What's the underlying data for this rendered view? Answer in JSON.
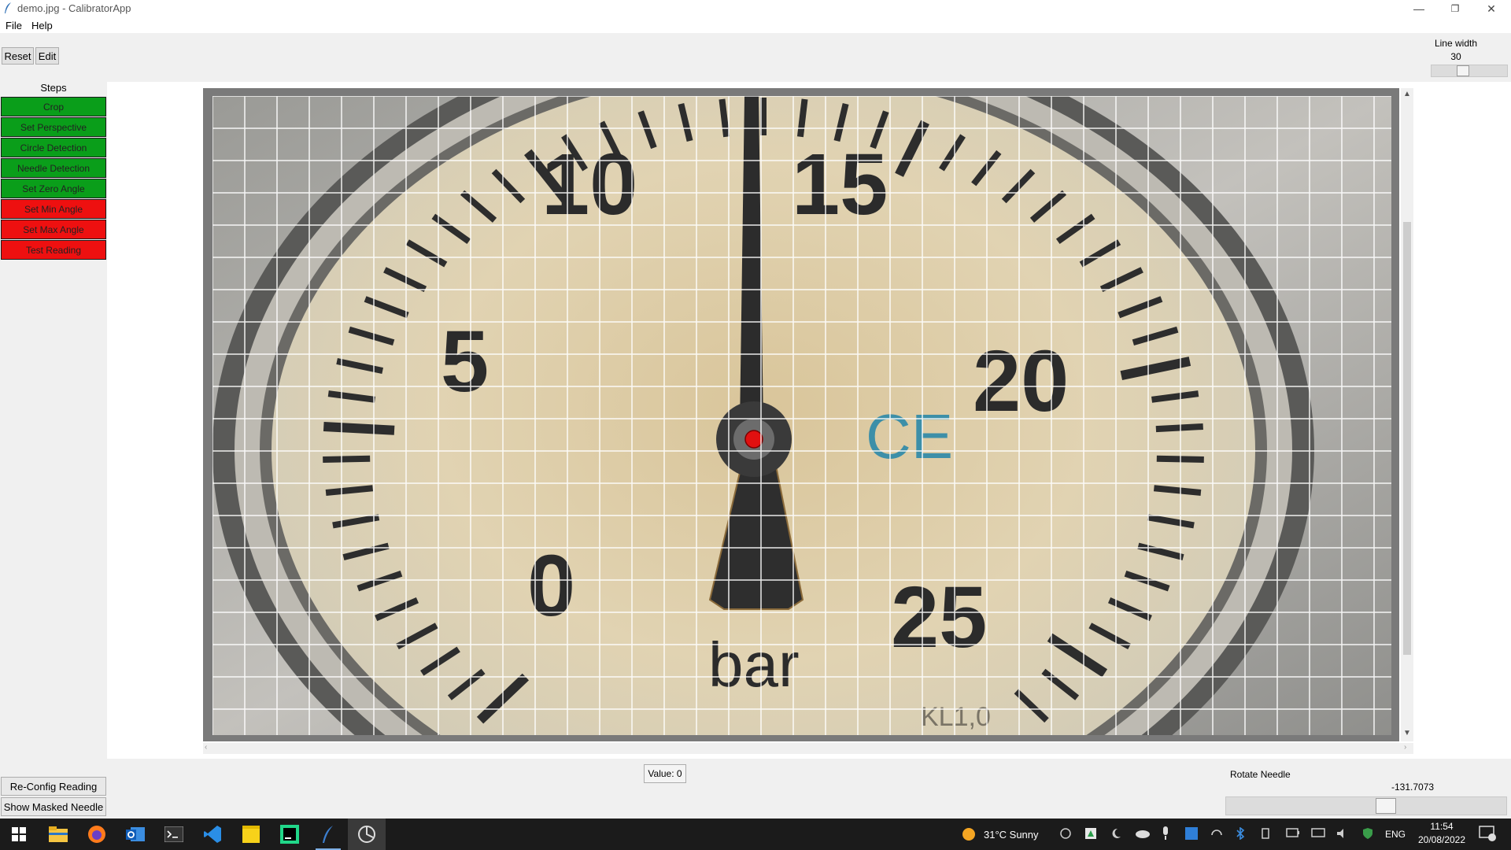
{
  "window": {
    "title": "demo.jpg - CalibratorApp"
  },
  "menu": {
    "items": [
      "File",
      "Help"
    ]
  },
  "toolbar": {
    "reset_label": "Reset",
    "edit_label": "Edit"
  },
  "line_width": {
    "label": "Line width",
    "value": "30"
  },
  "steps": {
    "title": "Steps",
    "items": [
      {
        "label": "Crop",
        "status": "done"
      },
      {
        "label": "Set Perspective",
        "status": "done"
      },
      {
        "label": "Circle Detection",
        "status": "done"
      },
      {
        "label": "Needle Detection",
        "status": "done"
      },
      {
        "label": "Set Zero Angle",
        "status": "done"
      },
      {
        "label": "Set Min Angle",
        "status": "todo"
      },
      {
        "label": "Set Max Angle",
        "status": "todo"
      },
      {
        "label": "Test Reading",
        "status": "todo"
      }
    ]
  },
  "gauge": {
    "numbers": [
      "10",
      "15",
      "5",
      "20",
      "0",
      "25"
    ],
    "unit": "bar",
    "mark": "CE",
    "class_label": "KL1,0"
  },
  "bottom": {
    "reconfig_label": "Re-Config Reading",
    "show_masked_label": "Show Masked Needle",
    "value_label": "Value: 0",
    "rotate_label": "Rotate Needle",
    "rotate_value": "-131.7073"
  },
  "taskbar": {
    "weather": "31°C  Sunny",
    "language": "ENG",
    "time": "11:54",
    "date": "20/08/2022"
  },
  "colors": {
    "done": "#0a9e1a",
    "todo": "#ee1010",
    "marker": "#e01010"
  }
}
